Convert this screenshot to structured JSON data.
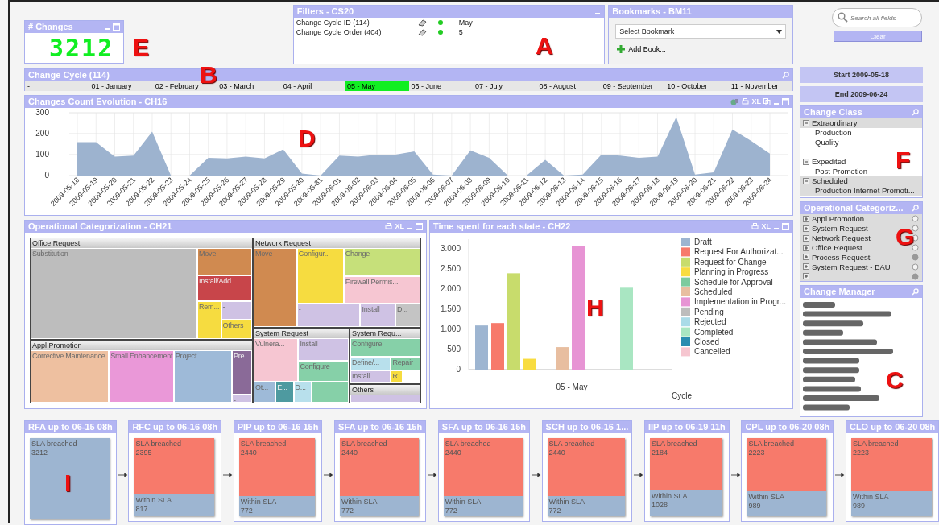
{
  "changes_box": {
    "title": "# Changes",
    "value": "3212"
  },
  "filters": {
    "title": "Filters - CS20",
    "rows": [
      {
        "field": "Change Cycle ID (114)",
        "value": "May"
      },
      {
        "field": "Change Cycle Order (404)",
        "value": "5"
      }
    ]
  },
  "bookmarks": {
    "title": "Bookmarks - BM11",
    "select": "Select Bookmark",
    "add": "Add Book..."
  },
  "search": {
    "placeholder": "Search all fields",
    "clear": "Clear"
  },
  "change_cycle": {
    "title": "Change Cycle (114)",
    "items": [
      {
        "label": "-",
        "selected": false
      },
      {
        "label": "01 - January",
        "selected": false
      },
      {
        "label": "02 - February",
        "selected": false
      },
      {
        "label": "03 - March",
        "selected": false
      },
      {
        "label": "04 - April",
        "selected": false
      },
      {
        "label": "05 - May",
        "selected": true
      },
      {
        "label": "06 - June",
        "selected": false
      },
      {
        "label": "07 - July",
        "selected": false
      },
      {
        "label": "08 - August",
        "selected": false
      },
      {
        "label": "09 - September",
        "selected": false
      },
      {
        "label": "10 - October",
        "selected": false
      },
      {
        "label": "11 - November",
        "selected": false
      }
    ]
  },
  "dates": {
    "start": "Start 2009-05-18",
    "end": "End 2009-06-24"
  },
  "line_chart": {
    "title": "Changes Count Evolution - CH16",
    "excel": "XL",
    "chart_data": {
      "type": "area",
      "x": [
        "2009-05-18",
        "2009-05-19",
        "2009-05-20",
        "2009-05-21",
        "2009-05-22",
        "2009-05-23",
        "2009-05-24",
        "2009-05-25",
        "2009-05-26",
        "2009-05-27",
        "2009-05-28",
        "2009-05-29",
        "2009-05-30",
        "2009-05-31",
        "2009-06-01",
        "2009-06-02",
        "2009-06-03",
        "2009-06-04",
        "2009-06-05",
        "2009-06-06",
        "2009-06-07",
        "2009-06-08",
        "2009-06-09",
        "2009-06-10",
        "2009-06-11",
        "2009-06-12",
        "2009-06-13",
        "2009-06-14",
        "2009-06-15",
        "2009-06-16",
        "2009-06-17",
        "2009-06-18",
        "2009-06-19",
        "2009-06-20",
        "2009-06-21",
        "2009-06-22",
        "2009-06-23",
        "2009-06-24"
      ],
      "grid": true,
      "series": [
        {
          "color": "#9db3cf",
          "values": [
            160,
            160,
            90,
            95,
            210,
            0,
            0,
            85,
            82,
            90,
            82,
            125,
            10,
            0,
            95,
            90,
            100,
            100,
            115,
            5,
            0,
            120,
            85,
            0,
            0,
            75,
            0,
            5,
            100,
            95,
            85,
            90,
            280,
            5,
            15,
            220,
            165,
            105
          ]
        }
      ],
      "ylim": [
        0,
        300
      ],
      "yticks": [
        0,
        100,
        200,
        300
      ]
    }
  },
  "treemap": {
    "title": "Operational Categorization - CH21",
    "excel": "XL",
    "groups": [
      {
        "title": "Office Request",
        "cells": [
          {
            "label": "Substitution",
            "color": "#bdbdbd"
          },
          {
            "label": "Move",
            "color": "#d08a50"
          },
          {
            "label": "Install/Add",
            "color": "#c8454a"
          },
          {
            "label": "Rem...",
            "color": "#f6dc40"
          },
          {
            "label": "-",
            "color": "#cfc2e4"
          },
          {
            "label": "Others",
            "color": "#f6dc40"
          }
        ]
      },
      {
        "title": "Appl Promotion",
        "cells": [
          {
            "label": "Corrective Maintenance",
            "color": "#eec0a0"
          },
          {
            "label": "Small Enhancement",
            "color": "#ea98d8"
          },
          {
            "label": "Project",
            "color": "#9ebad8"
          },
          {
            "label": "Pre...",
            "color": "#8a6a98"
          },
          {
            "label": "-",
            "color": "#cfc2e4"
          }
        ]
      },
      {
        "title": "Network Request",
        "cells": [
          {
            "label": "Move",
            "color": "#d08a50"
          },
          {
            "label": "Configur...",
            "color": "#f6dc40"
          },
          {
            "label": "Change",
            "color": "#c6e07a"
          },
          {
            "label": "Firewall Permis...",
            "color": "#f6c6d2"
          },
          {
            "label": "-",
            "color": "#cfc2e4"
          },
          {
            "label": "Install",
            "color": "#cfc2e4"
          },
          {
            "label": "D...",
            "color": "#c4c4c4"
          }
        ]
      },
      {
        "title": "System Request",
        "cells": [
          {
            "label": "Vulnera...",
            "color": "#f6c6d2"
          },
          {
            "label": "Install",
            "color": "#cfc2e4"
          },
          {
            "label": "Configure",
            "color": "#86d0a8"
          },
          {
            "label": "Ot...",
            "color": "#9ebad8"
          },
          {
            "label": "E...",
            "color": "#4e9aa0"
          },
          {
            "label": "D...",
            "color": "#b8e0ec"
          },
          {
            "color": "#86d0a8"
          }
        ]
      },
      {
        "title": "System Requ...",
        "cells": [
          {
            "label": "Configure",
            "color": "#86d0a8"
          },
          {
            "label": "Define/...",
            "color": "#b8e0ec"
          },
          {
            "label": "Repair",
            "color": "#86d0a8"
          },
          {
            "label": "Install",
            "color": "#cfc2e4"
          },
          {
            "label": "R",
            "color": "#f6dc40"
          }
        ]
      },
      {
        "title": "Others",
        "cells": [
          {
            "color": "#cfc2e4"
          }
        ]
      }
    ]
  },
  "bar_chart": {
    "title": "Time spent for each state - CH22",
    "excel": "XL",
    "chart_data": {
      "type": "bar",
      "xlabel": "Cycle",
      "categories": [
        "05 - May"
      ],
      "series": [
        {
          "name": "Draft",
          "color": "#9db5d1",
          "values": [
            1100
          ]
        },
        {
          "name": "Request For Authorizat...",
          "color": "#f77a6b",
          "values": [
            1160
          ]
        },
        {
          "name": "Request for Change",
          "color": "#c8dc6c",
          "values": [
            2400
          ]
        },
        {
          "name": "Planning in Progress",
          "color": "#f8dc40",
          "values": [
            270
          ]
        },
        {
          "name": "Schedule for Approval",
          "color": "#7ccb9e",
          "values": [
            null
          ]
        },
        {
          "name": "Scheduled",
          "color": "#e8bea0",
          "values": [
            560
          ]
        },
        {
          "name": "Implementation in Progr...",
          "color": "#e794d4",
          "values": [
            3080
          ]
        },
        {
          "name": "Pending",
          "color": "#bdbdbd",
          "values": [
            null
          ]
        },
        {
          "name": "Rejected",
          "color": "#aadbe8",
          "values": [
            null
          ]
        },
        {
          "name": "Completed",
          "color": "#a9e6c2",
          "values": [
            2040
          ]
        },
        {
          "name": "Closed",
          "color": "#2a8db0",
          "values": [
            null
          ]
        },
        {
          "name": "Cancelled",
          "color": "#f6c6d0",
          "values": [
            null
          ]
        }
      ],
      "legend": true,
      "ylim": [
        0,
        3250
      ],
      "yticks": [
        {
          "value": 0,
          "label": "0"
        },
        {
          "value": 500,
          "label": "500"
        },
        {
          "value": 1000,
          "label": "1.000"
        },
        {
          "value": 1500,
          "label": "1.500"
        },
        {
          "value": 2000,
          "label": "2.000"
        },
        {
          "value": 2500,
          "label": "2.500"
        },
        {
          "value": 3000,
          "label": "3.000"
        }
      ]
    }
  },
  "change_class": {
    "title": "Change Class",
    "groups": [
      {
        "label": "Extraordinary",
        "excluded": true,
        "children": [
          {
            "label": "Production",
            "excluded": false
          },
          {
            "label": "Quality",
            "excluded": false
          }
        ]
      },
      {
        "label": "Expedited",
        "excluded": false,
        "children": [
          {
            "label": "Post Promotion",
            "excluded": false
          }
        ]
      },
      {
        "label": "Scheduled",
        "excluded": true,
        "children": [
          {
            "label": "Production Internet Promoti...",
            "excluded": true
          }
        ]
      }
    ]
  },
  "operational_list": {
    "title": "Operational Categoriz...",
    "items": [
      {
        "label": "Appl Promotion",
        "marked": false
      },
      {
        "label": "System Request",
        "marked": false
      },
      {
        "label": "Network Request",
        "marked": false
      },
      {
        "label": "Office Request",
        "marked": false
      },
      {
        "label": "Process Request",
        "marked": true
      },
      {
        "label": "System Request - BAU",
        "marked": false
      },
      {
        "marked": true
      }
    ]
  },
  "change_manager": {
    "title": "Change Manager"
  },
  "flow": [
    {
      "title": "RFA up to 06-15  08h",
      "segments": [
        {
          "label": "SLA breached",
          "value": "3212",
          "color": "#9db5d1"
        }
      ]
    },
    {
      "title": "RFC up to 06-16  08h",
      "segments": [
        {
          "label": "SLA breached",
          "value": "2395",
          "color": "#f77a6b"
        },
        {
          "label": "Within SLA",
          "value": "817",
          "color": "#9db5d1"
        }
      ]
    },
    {
      "title": "PIP up to 06-16  15h",
      "segments": [
        {
          "label": "SLA breached",
          "value": "2440",
          "color": "#f77a6b"
        },
        {
          "label": "Within SLA",
          "value": "772",
          "color": "#9db5d1"
        }
      ]
    },
    {
      "title": "SFA up to 06-16  15h",
      "segments": [
        {
          "label": "SLA breached",
          "value": "2440",
          "color": "#f77a6b"
        },
        {
          "label": "Within SLA",
          "value": "772",
          "color": "#9db5d1"
        }
      ]
    },
    {
      "title": "SFA up to 06-16  15h",
      "segments": [
        {
          "label": "SLA breached",
          "value": "2440",
          "color": "#f77a6b"
        },
        {
          "label": "Within SLA",
          "value": "772",
          "color": "#9db5d1"
        }
      ]
    },
    {
      "title": "SCH up to 06-16  1...",
      "segments": [
        {
          "label": "SLA breached",
          "value": "2440",
          "color": "#f77a6b"
        },
        {
          "label": "Within SLA",
          "value": "772",
          "color": "#9db5d1"
        }
      ]
    },
    {
      "title": "IIP up to 06-19  11h",
      "segments": [
        {
          "label": "SLA breached",
          "value": "2184",
          "color": "#f77a6b"
        },
        {
          "label": "Within SLA",
          "value": "1028",
          "color": "#9db5d1"
        }
      ]
    },
    {
      "title": "CPL up to 06-20  08h",
      "segments": [
        {
          "label": "SLA breached",
          "value": "2223",
          "color": "#f77a6b"
        },
        {
          "label": "Within SLA",
          "value": "989",
          "color": "#9db5d1"
        }
      ]
    },
    {
      "title": "CLO up to 06-20  08h",
      "segments": [
        {
          "label": "SLA breached",
          "value": "2223",
          "color": "#f77a6b"
        },
        {
          "label": "Within SLA",
          "value": "989",
          "color": "#9db5d1"
        }
      ]
    }
  ],
  "callouts": [
    {
      "letter": "A"
    },
    {
      "letter": "B"
    },
    {
      "letter": "C"
    },
    {
      "letter": "D"
    },
    {
      "letter": "E"
    },
    {
      "letter": "F"
    },
    {
      "letter": "G"
    },
    {
      "letter": "H"
    },
    {
      "letter": "I"
    }
  ]
}
